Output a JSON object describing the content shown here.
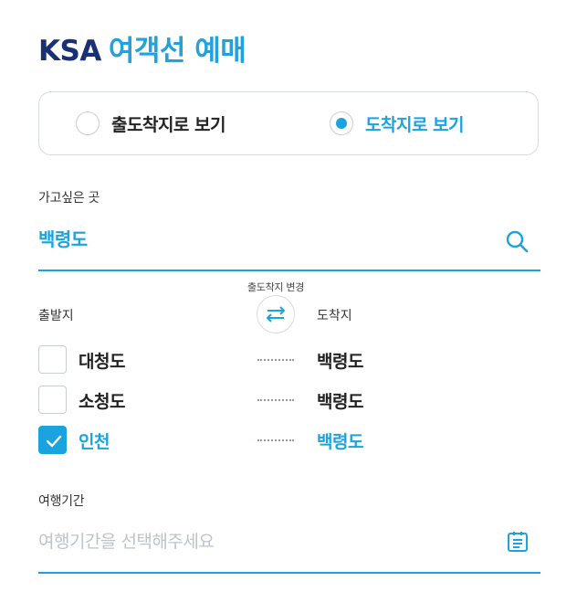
{
  "header": {
    "brand": "KSA",
    "title": "여객선 예매"
  },
  "view_toggle": {
    "options": [
      {
        "label": "출도착지로 보기",
        "selected": false
      },
      {
        "label": "도착지로 보기",
        "selected": true
      }
    ]
  },
  "destination": {
    "label": "가고싶은 곳",
    "value": "백령도",
    "search_icon": "search-icon"
  },
  "routes": {
    "swap_caption": "출도착지 변경",
    "swap_icon": "swap-arrows-icon",
    "from_header": "출발지",
    "to_header": "도착지",
    "items": [
      {
        "from": "대청도",
        "to": "백령도",
        "checked": false
      },
      {
        "from": "소청도",
        "to": "백령도",
        "checked": false
      },
      {
        "from": "인천",
        "to": "백령도",
        "checked": true
      }
    ]
  },
  "travel_period": {
    "label": "여행기간",
    "placeholder": "여행기간을 선택해주세요",
    "calendar_icon": "calendar-icon"
  },
  "colors": {
    "accent": "#1aa3df",
    "brand": "#1b2f73",
    "border": "#d6dbe1",
    "placeholder": "#bcc3cb"
  }
}
